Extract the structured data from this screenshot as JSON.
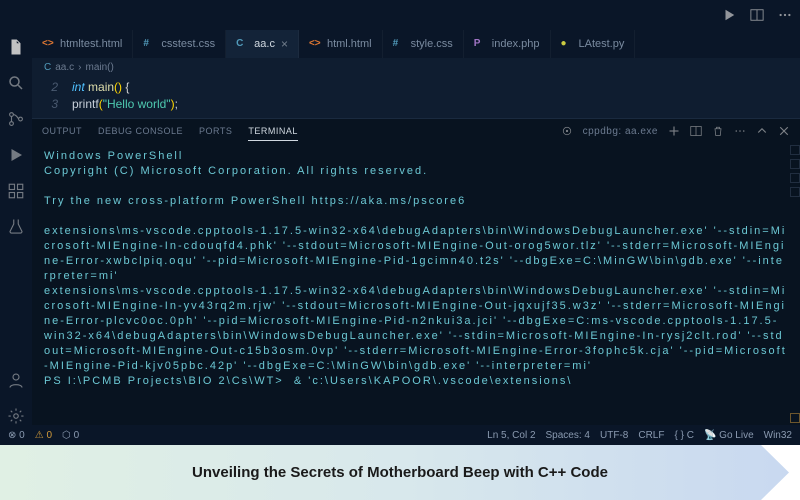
{
  "titlebar": {},
  "tabs": [
    {
      "label": "htmltest.html",
      "icon": "html",
      "active": false
    },
    {
      "label": "csstest.css",
      "icon": "css",
      "active": false
    },
    {
      "label": "aa.c",
      "icon": "c",
      "active": true
    },
    {
      "label": "html.html",
      "icon": "html",
      "active": false
    },
    {
      "label": "style.css",
      "icon": "css",
      "active": false
    },
    {
      "label": "index.php",
      "icon": "php",
      "active": false
    },
    {
      "label": "LAtest.py",
      "icon": "py",
      "active": false
    }
  ],
  "breadcrumb": {
    "file": "aa.c",
    "symbol": "main()"
  },
  "code": {
    "lines": [
      {
        "num": "2",
        "tokens": [
          {
            "t": "int",
            "c": "kw"
          },
          {
            "t": " main",
            "c": "fn"
          },
          {
            "t": "()",
            "c": "paren"
          },
          {
            "t": " {",
            "c": "brace"
          }
        ]
      },
      {
        "num": "3",
        "tokens": [
          {
            "t": "    printf",
            "c": "plain"
          },
          {
            "t": "(",
            "c": "paren"
          },
          {
            "t": "\"Hello world\"",
            "c": "str"
          },
          {
            "t": ")",
            "c": "paren"
          },
          {
            "t": ";",
            "c": "plain"
          }
        ]
      }
    ]
  },
  "panel": {
    "tabs": [
      "OUTPUT",
      "DEBUG CONSOLE",
      "PORTS",
      "TERMINAL"
    ],
    "active": "TERMINAL",
    "launch": "cppdbg: aa.exe"
  },
  "terminal_lines": [
    "Windows PowerShell",
    "Copyright (C) Microsoft Corporation. All rights reserved.",
    "",
    "Try the new cross-platform PowerShell https://aka.ms/pscore6",
    "",
    "extensions\\ms-vscode.cpptools-1.17.5-win32-x64\\debugAdapters\\bin\\WindowsDebugLauncher.exe' '--stdin=Microsoft-MIEngine-In-cdouqfd4.phk' '--stdout=Microsoft-MIEngine-Out-orog5wor.tlz' '--stderr=Microsoft-MIEngine-Error-xwbclpiq.oqu' '--pid=Microsoft-MIEngine-Pid-1gcimn40.t2s' '--dbgExe=C:\\MinGW\\bin\\gdb.exe' '--interpreter=mi'",
    "extensions\\ms-vscode.cpptools-1.17.5-win32-x64\\debugAdapters\\bin\\WindowsDebugLauncher.exe' '--stdin=Microsoft-MIEngine-In-yv43rq2m.rjw' '--stdout=Microsoft-MIEngine-Out-jqxujf35.w3z' '--stderr=Microsoft-MIEngine-Error-plcvc0oc.0ph' '--pid=Microsoft-MIEngine-Pid-n2nkui3a.jci' '--dbgExe=C:ms-vscode.cpptools-1.17.5-win32-x64\\debugAdapters\\bin\\WindowsDebugLauncher.exe' '--stdin=Microsoft-MIEngine-In-rysj2clt.rod' '--stdout=Microsoft-MIEngine-Out-c15b3osm.0vp' '--stderr=Microsoft-MIEngine-Error-3fophc5k.cja' '--pid=Microsoft-MIEngine-Pid-kjv05pbc.42p' '--dbgExe=C:\\MinGW\\bin\\gdb.exe' '--interpreter=mi'",
    "PS I:\\PCMB Projects\\BIO 2\\Cs\\WT>  & 'c:\\Users\\KAPOOR\\.vscode\\extensions\\"
  ],
  "statusbar": {
    "errors": "0",
    "warnings": "0",
    "ports": "0",
    "line_col": "Ln 5, Col 2",
    "spaces": "Spaces: 4",
    "encoding": "UTF-8",
    "eol": "CRLF",
    "lang": "{ } C",
    "golive": "Go Live",
    "platform": "Win32"
  },
  "banner": {
    "title": "Unveiling the Secrets of Motherboard Beep with C++ Code"
  }
}
